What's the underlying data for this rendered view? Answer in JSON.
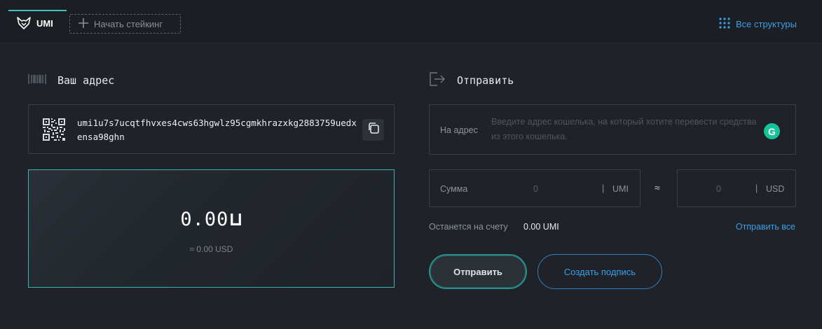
{
  "topbar": {
    "active_tab": "UMI",
    "stake_button": "Начать стейкинг",
    "all_structures": "Все структуры"
  },
  "address_section": {
    "title": "Ваш адрес",
    "address": "umi1u7s7ucqtfhvxes4cws63hgwlz95cgmkhrazxkg2883759uedxensa98ghn"
  },
  "balance": {
    "amount": "0.00",
    "currency_symbol": "⊔",
    "usd": "≈ 0.00 USD"
  },
  "send_section": {
    "title": "Отправить",
    "to_label": "На адрес",
    "to_placeholder": "Введите адрес кошелька, на который хотите перевести средства из этого кошелька.",
    "grammarly_glyph": "G",
    "amount_label": "Сумма",
    "amount_value": "0",
    "amount_unit": "UMI",
    "approx_sign": "≈",
    "usd_value": "0",
    "usd_unit": "USD",
    "separator": "|",
    "remaining_label": "Останется на счету",
    "remaining_value": "0.00 UMI",
    "send_all": "Отправить все",
    "send_button": "Отправить",
    "sign_button": "Создать подпись"
  },
  "colors": {
    "background": "#1f2329",
    "accent_teal": "#3ab4b0",
    "link_blue": "#3aa0e8"
  }
}
